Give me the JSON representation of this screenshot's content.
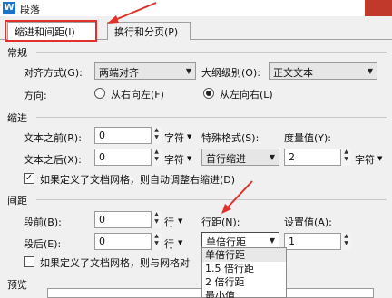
{
  "window": {
    "title": "段落",
    "app_icon": "W"
  },
  "tabs": [
    {
      "label": "缩进和间距(I)",
      "active": true
    },
    {
      "label": "换行和分页(P)",
      "active": false
    }
  ],
  "general": {
    "heading": "常规",
    "alignment_label": "对齐方式(G):",
    "alignment_value": "两端对齐",
    "outline_label": "大纲级别(O):",
    "outline_value": "正文文本",
    "direction_label": "方向:",
    "rtl_label": "从右向左(F)",
    "ltr_label": "从左向右(L)",
    "direction_selected": "ltr"
  },
  "indent": {
    "heading": "缩进",
    "before_label": "文本之前(R):",
    "before_value": "0",
    "before_unit": "字符",
    "after_label": "文本之后(X):",
    "after_value": "0",
    "after_unit": "字符",
    "special_label": "特殊格式(S):",
    "special_value": "首行缩进",
    "measure_label": "度量值(Y):",
    "measure_value": "2",
    "measure_unit": "字符",
    "grid_checkbox_label": "如果定义了文档网格，则自动调整右缩进(D)",
    "grid_checked": true
  },
  "spacing": {
    "heading": "间距",
    "before_label": "段前(B):",
    "before_value": "0",
    "before_unit": "行",
    "after_label": "段后(E):",
    "after_value": "0",
    "after_unit": "行",
    "line_label": "行距(N):",
    "line_value": "单倍行距",
    "setting_label": "设置值(A):",
    "setting_value": "1",
    "grid_checkbox_label": "如果定义了文档网格，则与网格对",
    "grid_checked": false,
    "line_options": [
      "单倍行距",
      "1.5 倍行距",
      "2 倍行距",
      "最小值"
    ]
  },
  "preview": {
    "heading": "预览"
  },
  "colors": {
    "highlight": "#e0312a",
    "close": "#c0392b"
  },
  "icons": {
    "app": "wps-writer-icon",
    "arrow": "red-annotation-arrow"
  }
}
